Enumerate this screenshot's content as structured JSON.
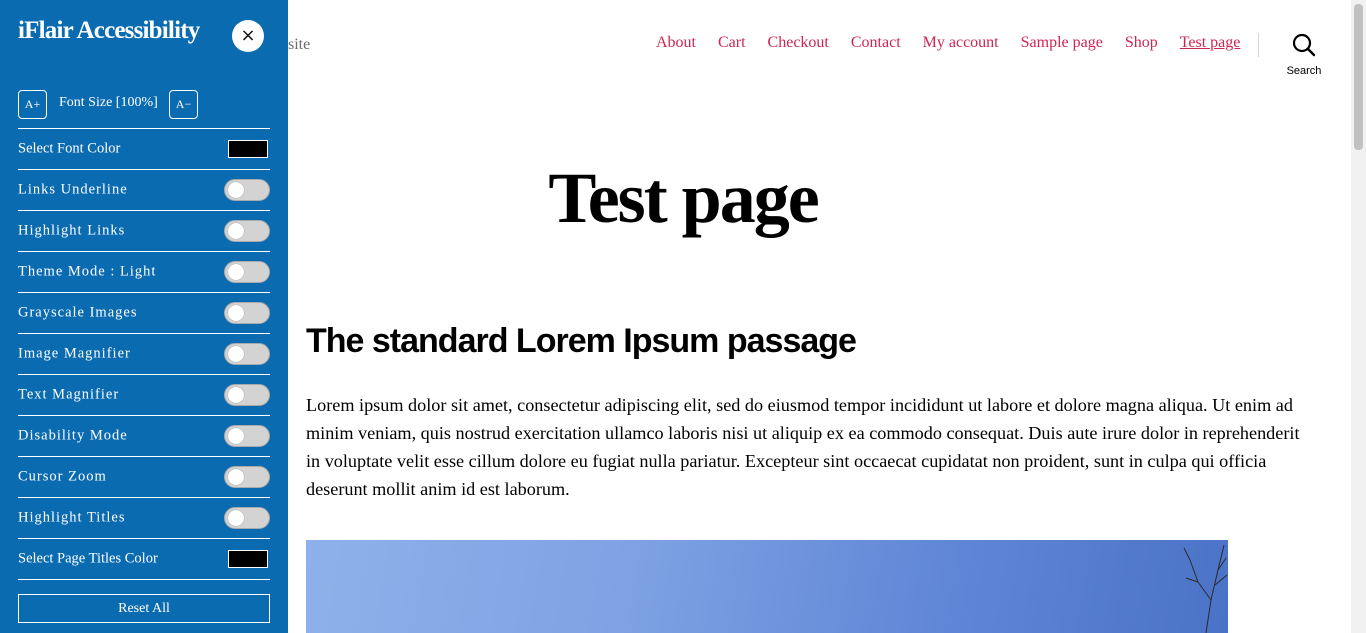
{
  "site": {
    "description_fragment": "site",
    "nav": [
      {
        "label": "About",
        "current": false
      },
      {
        "label": "Cart",
        "current": false
      },
      {
        "label": "Checkout",
        "current": false
      },
      {
        "label": "Contact",
        "current": false
      },
      {
        "label": "My account",
        "current": false
      },
      {
        "label": "Sample page",
        "current": false
      },
      {
        "label": "Shop",
        "current": false
      },
      {
        "label": "Test page",
        "current": true
      }
    ],
    "search_label": "Search",
    "accent_color": "#cd2653"
  },
  "main": {
    "page_title": "Test page",
    "section_heading": "The standard Lorem Ipsum passage",
    "body_text": "Lorem ipsum dolor sit amet, consectetur adipiscing elit, sed do eiusmod tempor incididunt ut labore et dolore magna aliqua. Ut enim ad minim veniam, quis nostrud exercitation ullamco laboris nisi ut aliquip ex ea commodo consequat. Duis aute irure dolor in reprehenderit in voluptate velit esse cillum dolore eu fugiat nulla pariatur. Excepteur sint occaecat cupidatat non proident, sunt in culpa qui officia deserunt mollit anim id est laborum."
  },
  "panel": {
    "title": "iFlair Accessibility",
    "background_color": "#0b6bb1",
    "close_icon": "×",
    "font_increase_label": "A+",
    "font_decrease_label": "A−",
    "font_size_label": "Font Size [100%]",
    "font_color_label": "Select Font Color",
    "font_color_value": "#000000",
    "toggles": [
      {
        "label": "Links Underline",
        "on": false
      },
      {
        "label": "Highlight Links",
        "on": false
      },
      {
        "label": "Theme Mode : Light",
        "on": false
      },
      {
        "label": "Grayscale Images",
        "on": false
      },
      {
        "label": "Image Magnifier",
        "on": false
      },
      {
        "label": "Text Magnifier",
        "on": false
      },
      {
        "label": "Disability Mode",
        "on": false
      },
      {
        "label": "Cursor Zoom",
        "on": false
      },
      {
        "label": "Highlight Titles",
        "on": false
      }
    ],
    "titles_color_label": "Select Page Titles Color",
    "titles_color_value": "#000000",
    "reset_label": "Reset All"
  }
}
